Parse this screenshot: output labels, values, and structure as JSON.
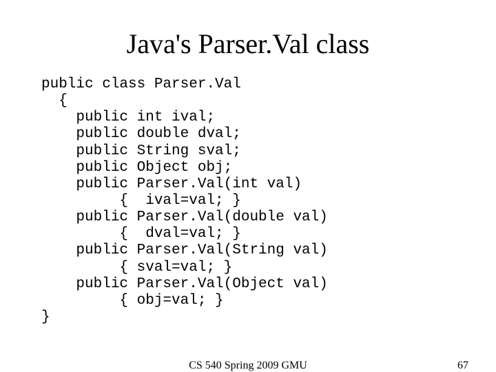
{
  "slide": {
    "title": "Java's Parser.Val class",
    "code": "public class Parser.Val\n  {\n    public int ival;\n    public double dval;\n    public String sval;\n    public Object obj;\n    public Parser.Val(int val)\n         {  ival=val; }\n    public Parser.Val(double val)\n         {  dval=val; }\n    public Parser.Val(String val)\n         { sval=val; }\n    public Parser.Val(Object val)\n         { obj=val; }\n}"
  },
  "footer": {
    "center": "CS 540 Spring 2009 GMU",
    "page": "67"
  }
}
